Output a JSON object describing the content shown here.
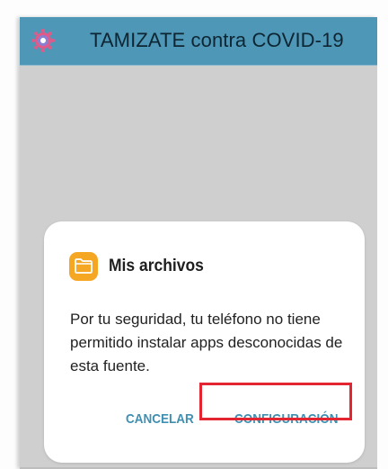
{
  "app_bar": {
    "title": "TAMIZATE contra COVID-19",
    "logo_icon": "virus-icon",
    "background": "#4e97b6"
  },
  "dialog": {
    "app_icon": "folder-icon",
    "title": "Mis archivos",
    "message": "Por tu seguridad, tu teléfono no tiene permitido instalar apps desconocidas de esta fuente.",
    "cancel_label": "CANCELAR",
    "settings_label": "CONFIGURACIÓN",
    "accent": "#3f8fb1",
    "highlight_color": "#e32531"
  }
}
